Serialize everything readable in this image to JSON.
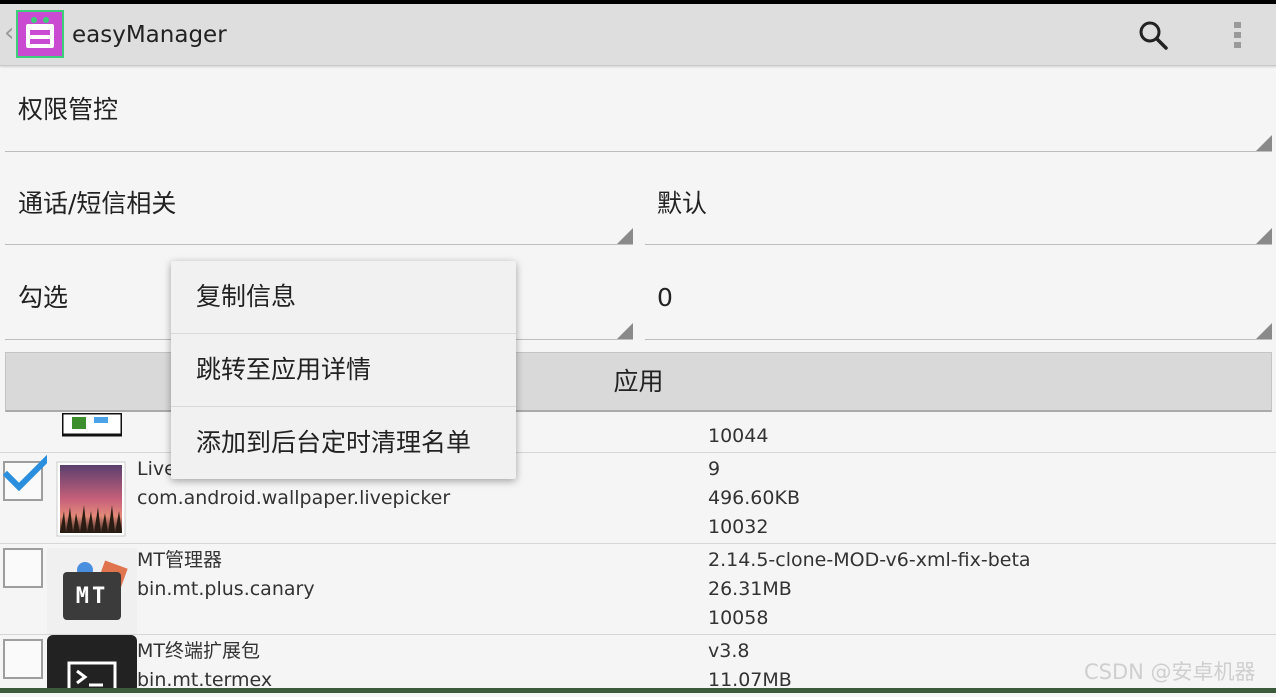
{
  "app": {
    "title": "easyManager"
  },
  "icons": {
    "search": "search-icon",
    "overflow": "overflow-menu-icon",
    "back": "back-caret-icon",
    "app": "android-app-icon"
  },
  "filters": {
    "permission_control": "权限管控",
    "call_sms_related": "通话/短信相关",
    "default_label": "默认",
    "check_label": "勾选",
    "check_value": "0"
  },
  "apply_button": "应用",
  "context_menu": {
    "items": [
      "复制信息",
      "跳转至应用详情",
      "添加到后台定时清理名单"
    ]
  },
  "apps": [
    {
      "name": "",
      "package": "",
      "version": "",
      "size": "",
      "uid": "10044",
      "checked": false
    },
    {
      "name": "Live",
      "package": "com.android.wallpaper.livepicker",
      "version": "9",
      "size": "496.60KB",
      "uid": "10032",
      "checked": true
    },
    {
      "name": "MT管理器",
      "package": "bin.mt.plus.canary",
      "version": "2.14.5-clone-MOD-v6-xml-fix-beta",
      "size": "26.31MB",
      "uid": "10058",
      "checked": false
    },
    {
      "name": "MT终端扩展包",
      "package": "bin.mt.termex",
      "version": "v3.8",
      "size": "11.07MB",
      "uid": "",
      "checked": false
    }
  ],
  "icon_labels": {
    "mt": "MT"
  },
  "watermark": "CSDN @安卓机器",
  "colors": {
    "accent_check": "#2b8fe0",
    "app_icon_bg": "#c94bd2",
    "app_icon_border": "#3ccf7a"
  }
}
